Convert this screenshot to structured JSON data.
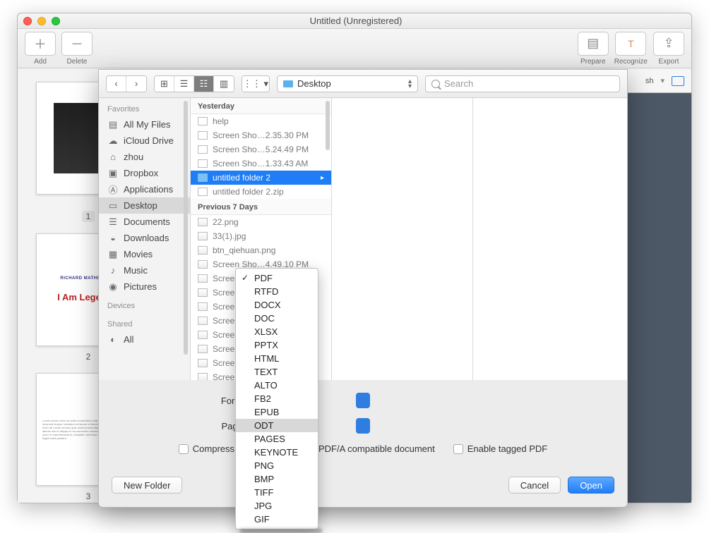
{
  "window": {
    "title": "Untitled (Unregistered)"
  },
  "toolbar": {
    "add": "Add",
    "delete": "Delete",
    "prepare": "Prepare",
    "recognize": "Recognize",
    "export": "Export"
  },
  "righttabs": {
    "sh": "sh"
  },
  "thumbs": {
    "n1": "1",
    "n2": "2",
    "n3": "3",
    "legend": "I Am Legen",
    "author": "RICHARD MATHES"
  },
  "sheet": {
    "location": "Desktop",
    "search_ph": "Search",
    "sidebar": {
      "favorites": "Favorites",
      "devices": "Devices",
      "shared": "Shared",
      "items": {
        "allfiles": "All My Files",
        "icloud": "iCloud Drive",
        "zhou": "zhou",
        "dropbox": "Dropbox",
        "applications": "Applications",
        "desktop": "Desktop",
        "documents": "Documents",
        "downloads": "Downloads",
        "movies": "Movies",
        "music": "Music",
        "pictures": "Pictures",
        "all": "All"
      }
    },
    "col": {
      "yesterday": "Yesterday",
      "prev7": "Previous 7 Days",
      "files": {
        "help": "help",
        "ss1": "Screen Sho…2.35.30 PM",
        "ss2": "Screen Sho…5.24.49 PM",
        "ss3": "Screen Sho…1.33.43 AM",
        "uf2": "untitled folder 2",
        "uf2zip": "untitled folder 2.zip",
        "p22": "22.png",
        "p33": "33(1).jpg",
        "btn": "btn_qiehuan.png",
        "ss4": "Screen Sho…4.49.10 PM",
        "sA": "Screen",
        "sB": "Screen",
        "sC": "Screen",
        "sD": "Screen",
        "sE": "Screen",
        "sF": "Screen",
        "sG": "Screen",
        "sH": "Screen"
      }
    },
    "opts": {
      "format": "Format",
      "pages": "Pages:",
      "compress": "Compress images usin",
      "pdfa": "PDF/A compatible document",
      "tagged": "Enable tagged PDF"
    },
    "buttons": {
      "newfolder": "New Folder",
      "cancel": "Cancel",
      "open": "Open"
    }
  },
  "formats": {
    "pdf": "PDF",
    "rtfd": "RTFD",
    "docx": "DOCX",
    "doc": "DOC",
    "xlsx": "XLSX",
    "pptx": "PPTX",
    "html": "HTML",
    "text": "TEXT",
    "alto": "ALTO",
    "fb2": "FB2",
    "epub": "EPUB",
    "odt": "ODT",
    "pages": "PAGES",
    "keynote": "KEYNOTE",
    "png": "PNG",
    "bmp": "BMP",
    "tiff": "TIFF",
    "jpg": "JPG",
    "gif": "GIF"
  }
}
